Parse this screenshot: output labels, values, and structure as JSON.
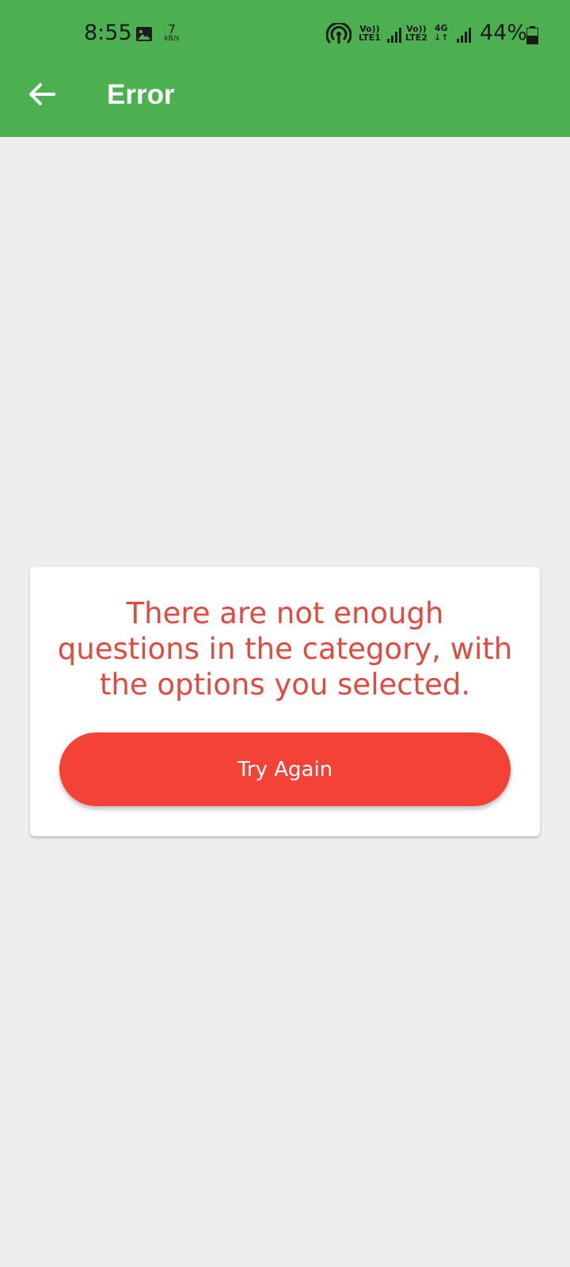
{
  "status_bar": {
    "time": "8:55",
    "net_speed_value": "7",
    "net_speed_unit": "kB/s",
    "sim1_label_top": "Vo))",
    "sim1_label_bottom": "LTE1",
    "sim2_label_top": "Vo))",
    "sim2_label_bottom": "LTE2",
    "network_type": "4G",
    "battery_percent": "44%"
  },
  "app_bar": {
    "title": "Error"
  },
  "card": {
    "message": "There are not enough questions in the category, with the options you selected.",
    "button_label": "Try Again"
  },
  "colors": {
    "app_bar": "#4caf50",
    "background": "#eeeeee",
    "message_text": "#e04a3f",
    "button": "#f44336"
  }
}
